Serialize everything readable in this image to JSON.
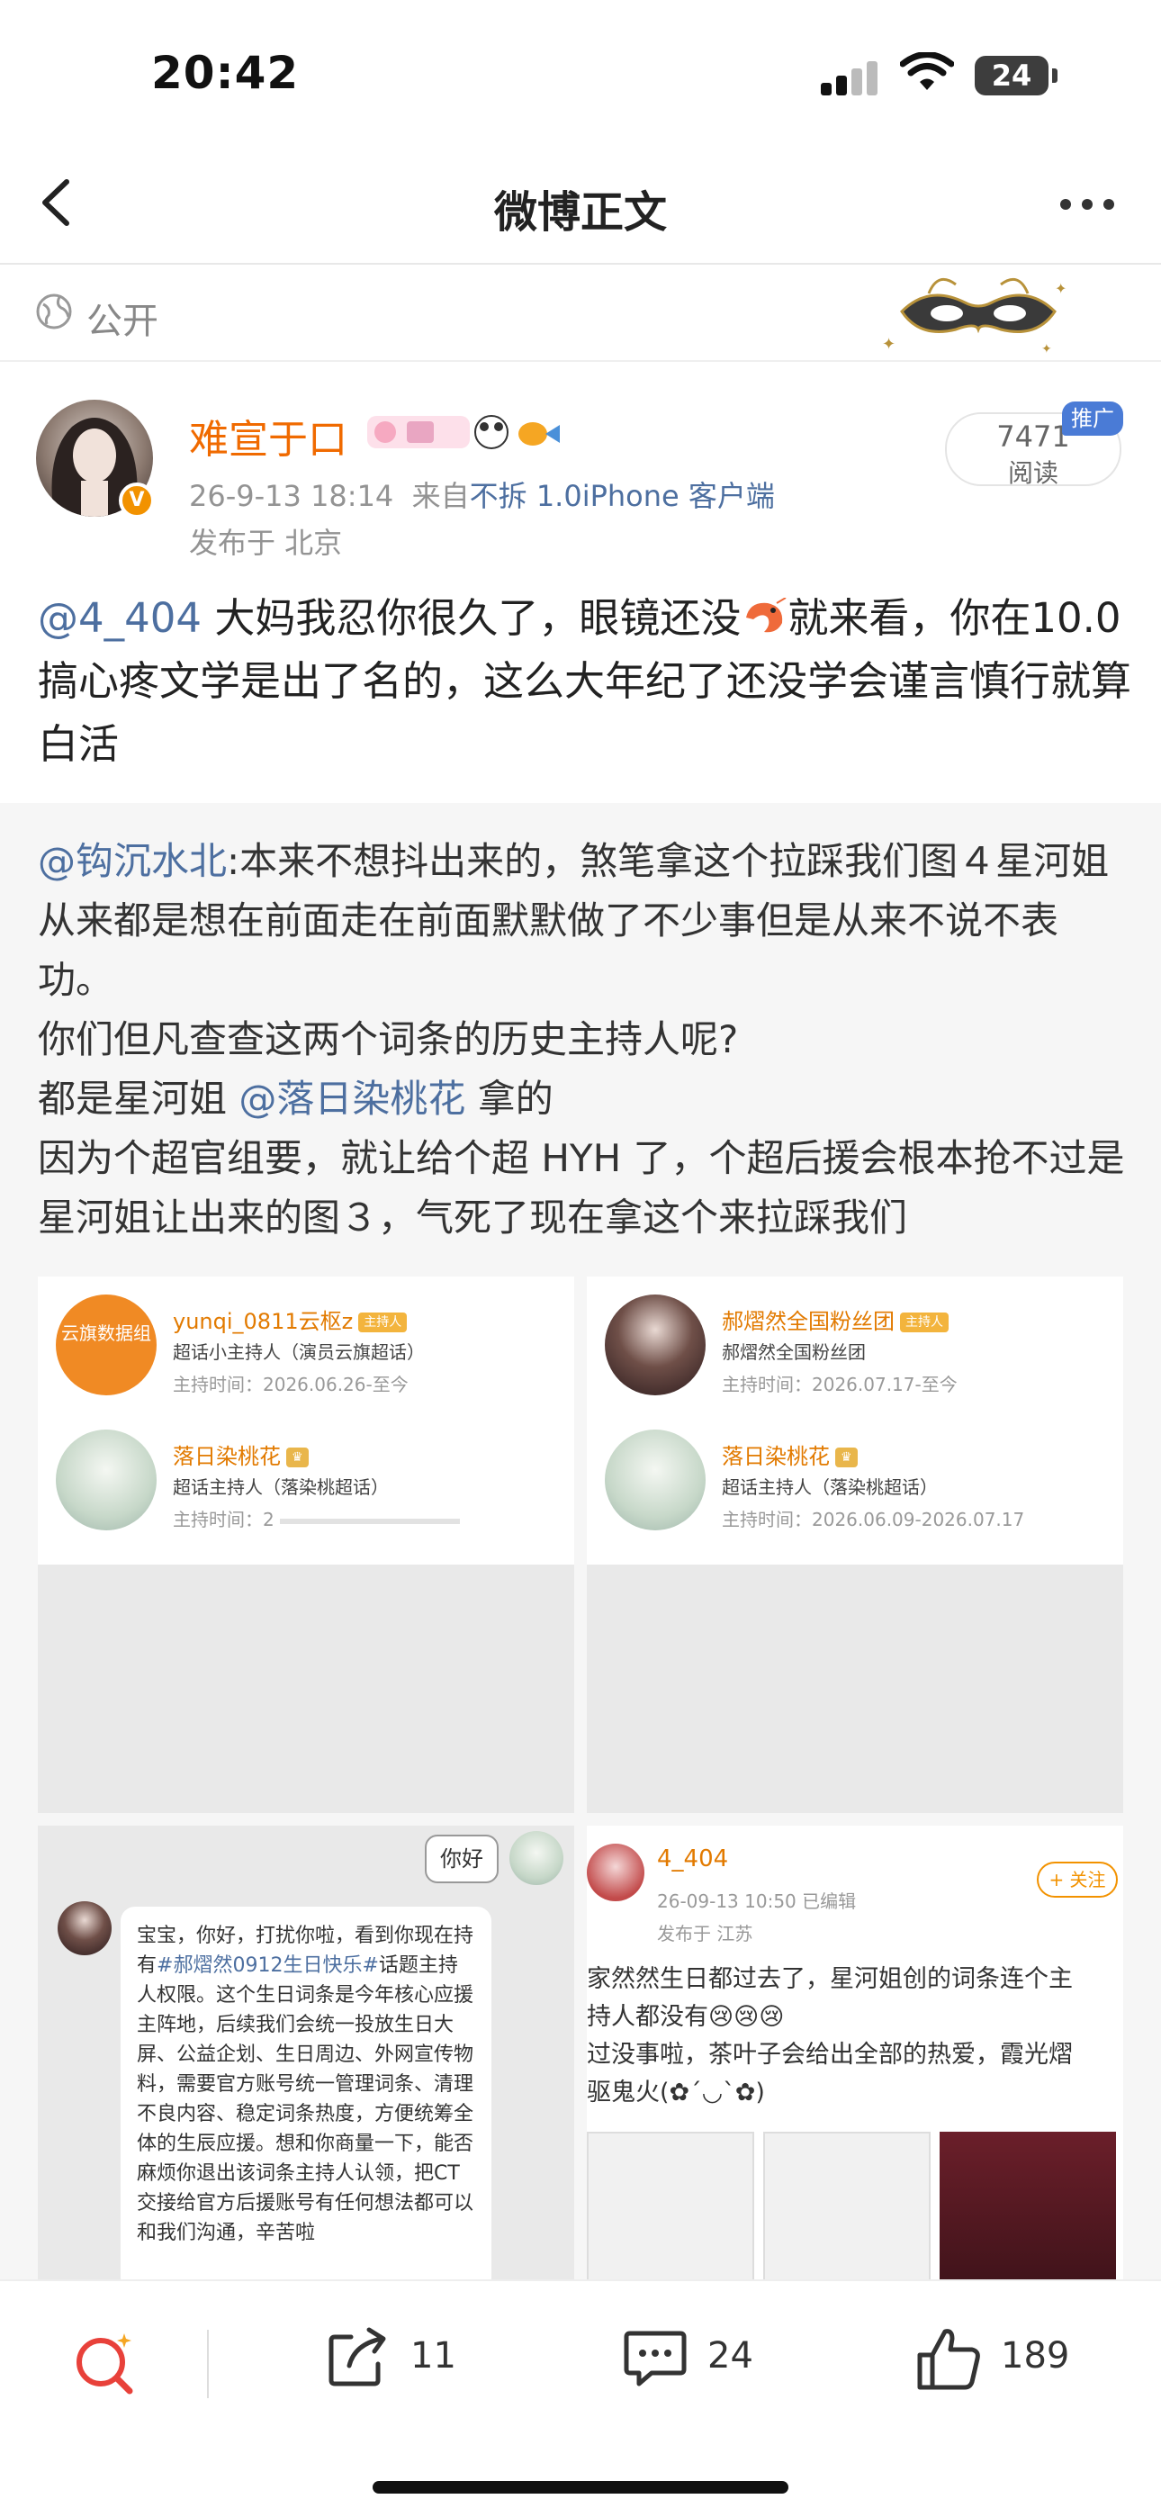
{
  "status": {
    "time": "20:42",
    "battery": "24"
  },
  "nav": {
    "title": "微博正文"
  },
  "visibility": {
    "label": "公开"
  },
  "post": {
    "author": "难宣于口",
    "timestamp": "26-9-13 18:14",
    "source_prefix": "来自",
    "source_link": "不拆 1.0iPhone 客户端",
    "location": "发布于 北京",
    "read_count": "7471",
    "read_label": "阅读",
    "promo_tag": "推广",
    "mention": "@4_404",
    "text_before_emoji": " 大妈我忍你很久了，眼镜还没",
    "text_after_emoji": "就来看，你在10.0搞心疼文学是出了名的，这么大年纪了还没学会谨言慎行就算白活"
  },
  "repost": {
    "mention": "@钩沉水北",
    "line1": ":本来不想抖出来的，煞笔拿这个拉踩我们图４星河姐从来都是想在前面走在前面默默做了不少事但是从来不说不表功。",
    "line2": "你们但凡查查这两个词条的历史主持人呢?",
    "line3_prefix": "都是星河姐 ",
    "line3_mention": "@落日染桃花",
    "line3_suffix": " 拿的",
    "line4": "因为个超官组要，就让给个超 HYH 了，个超后援会根本抢不过是星河姐让出来的图３，气死了现在拿这个来拉踩我们"
  },
  "images": {
    "img1": {
      "host1_name": "yunqi_0811云枢z",
      "host1_badge": "主持人",
      "host1_role": "超话小主持人（演员云旗超话）",
      "host1_time": "主持时间：2026.06.26-至今",
      "host1_avatar_text": "云旗数据组",
      "host2_name": "落日染桃花",
      "host2_role": "超话主持人（落染桃超话）",
      "host2_time": "主持时间：2"
    },
    "img2": {
      "host1_name": "郝熠然全国粉丝团",
      "host1_badge": "主持人",
      "host1_role": "郝熠然全国粉丝团",
      "host1_time": "主持时间：2026.07.17-至今",
      "host2_name": "落日染桃花",
      "host2_role": "超话主持人（落染桃超话）",
      "host2_time": "主持时间：2026.06.09-2026.07.17"
    },
    "img3": {
      "hello": "你好",
      "chat_before": "宝宝，你好，打扰你啦，看到你现在持有",
      "chat_hashtag": "#郝熠然0912生日快乐#",
      "chat_after": "话题主持人权限。这个生日词条是今年核心应援主阵地，后续我们会统一投放生日大屏、公益企划、生日周边、外网宣传物料，需要官方账号统一管理词条、清理不良内容、稳定词条热度，方便统筹全体的生辰应援。想和你商量一下，能否麻烦你退出该词条主持人认领，把CT交接给官方后援账号有任何想法都可以和我们沟通，辛苦啦"
    },
    "img4": {
      "name": "4_404",
      "meta": "26-09-13 10:50  已编辑",
      "location": "发布于 江苏",
      "follow": "+ 关注",
      "line1": "家然然生日都过去了，星河姐创的词条连个主",
      "line2": "持人都没有😢😢😢",
      "line3": "过没事啦，茶叶子会给出全部的热爱，霞光熠",
      "line4": "驱鬼火(✿´◡`✿)"
    }
  },
  "actions": {
    "repost_count": "11",
    "comment_count": "24",
    "like_count": "189"
  },
  "colors": {
    "brand_orange": "#f06a00",
    "link_blue": "#4d6fa0"
  }
}
